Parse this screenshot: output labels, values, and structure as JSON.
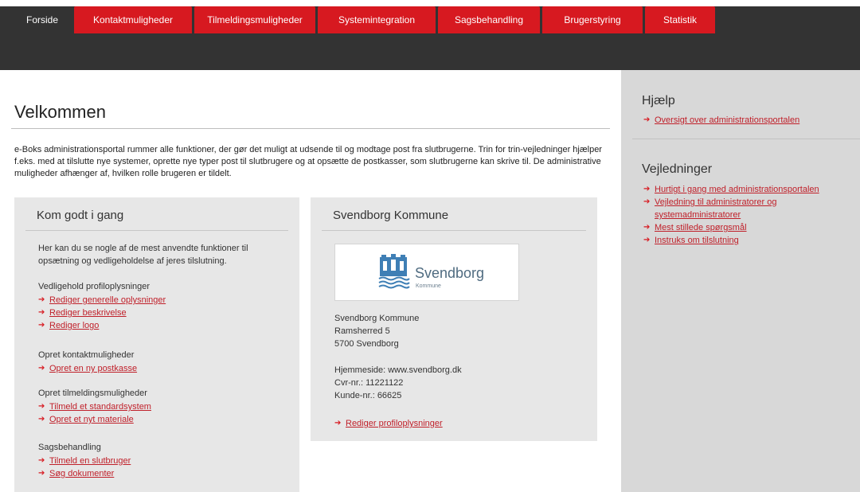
{
  "nav": {
    "tabs": [
      {
        "label": "Forside",
        "active": true
      },
      {
        "label": "Kontaktmuligheder",
        "active": false
      },
      {
        "label": "Tilmeldingsmuligheder",
        "active": false
      },
      {
        "label": "Systemintegration",
        "active": false
      },
      {
        "label": "Sagsbehandling",
        "active": false
      },
      {
        "label": "Brugerstyring",
        "active": false
      },
      {
        "label": "Statistik",
        "active": false
      }
    ]
  },
  "main": {
    "title": "Velkommen",
    "intro": "e-Boks administrationsportal rummer alle funktioner, der gør det muligt at udsende til og modtage post fra slutbrugerne. Trin for trin-vejledninger hjælper f.eks. med at tilslutte nye systemer, oprette nye typer post til slutbrugere og at opsætte de postkasser, som slutbrugerne kan skrive til. De administrative muligheder afhænger af, hvilken rolle brugeren er tildelt."
  },
  "getting_started": {
    "title": "Kom godt i gang",
    "intro": "Her kan du se nogle af de mest anvendte funktioner til opsætning og vedligeholdelse af jeres tilslutning.",
    "groups": [
      {
        "heading": "Vedligehold profiloplysninger",
        "links": [
          "Rediger generelle oplysninger",
          "Rediger beskrivelse",
          "Rediger logo"
        ]
      },
      {
        "heading": "Opret kontaktmuligheder",
        "links": [
          "Opret en ny postkasse"
        ]
      },
      {
        "heading": "Opret tilmeldingsmuligheder",
        "links": [
          "Tilmeld et standardsystem",
          "Opret et nyt materiale"
        ]
      },
      {
        "heading": "Sagsbehandling",
        "links": [
          "Tilmeld en slutbruger",
          "Søg dokumenter"
        ]
      }
    ]
  },
  "profile": {
    "title": "Svendborg Kommune",
    "logo_name": "Svendborg",
    "logo_sub": "Kommune",
    "address": [
      "Svendborg Kommune",
      "Ramsherred 5",
      "5700 Svendborg"
    ],
    "details": [
      "Hjemmeside: www.svendborg.dk",
      "Cvr-nr.: 11221122",
      "Kunde-nr.: 66625"
    ],
    "edit_link": "Rediger profiloplysninger"
  },
  "sidebar": {
    "help_title": "Hjælp",
    "help_links": [
      "Oversigt over administrationsportalen"
    ],
    "guides_title": "Vejledninger",
    "guides_links": [
      "Hurtigt i gang med administrationsportalen",
      "Vejledning til administratorer og systemadministratorer",
      "Mest stillede spørgsmål",
      "Instruks om tilslutning"
    ]
  },
  "colors": {
    "accent": "#d71920",
    "nav_bg": "#333333",
    "sidebar_bg": "#d8d8d8",
    "panel_bg": "#e7e7e7",
    "link": "#c0202a",
    "logo": "#3f7fb5"
  }
}
